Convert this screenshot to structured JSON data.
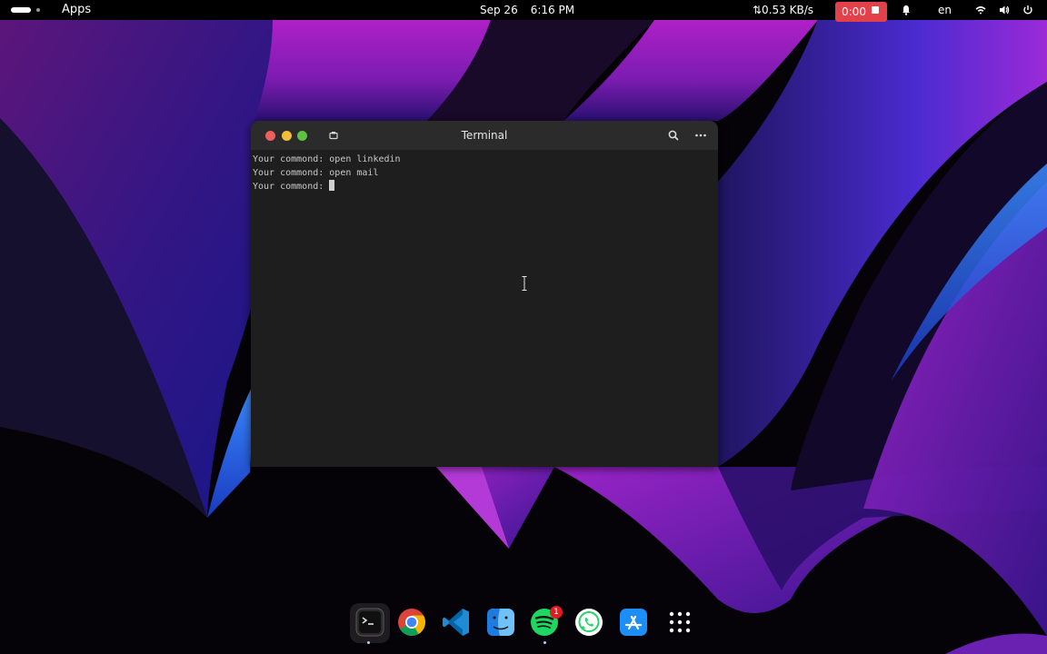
{
  "topbar": {
    "apps_label": "Apps",
    "date": "Sep 26",
    "time": "6:16 PM",
    "net_speed": "⇅0.53 KB/s",
    "recording_time": "0:00",
    "language": "en",
    "icons": [
      "activities-indicator",
      "bell-icon",
      "wifi-icon",
      "volume-icon",
      "power-icon"
    ]
  },
  "terminal": {
    "title": "Terminal",
    "lines": [
      "Your commond: open linkedin",
      "Your commond: open mail",
      "Your commond: "
    ]
  },
  "dock": {
    "apps": [
      "terminal",
      "chrome",
      "vscode",
      "finder",
      "spotify",
      "whatsapp",
      "app-store",
      "show-applications"
    ],
    "spotify_badge": "1"
  },
  "colors": {
    "recording": "#e2414a",
    "close": "#ec5f5c",
    "minimize": "#f1bd3b",
    "maximize": "#5ec142",
    "terminal_bg": "#1e1e1e",
    "header_bg": "#2b2b2b"
  }
}
